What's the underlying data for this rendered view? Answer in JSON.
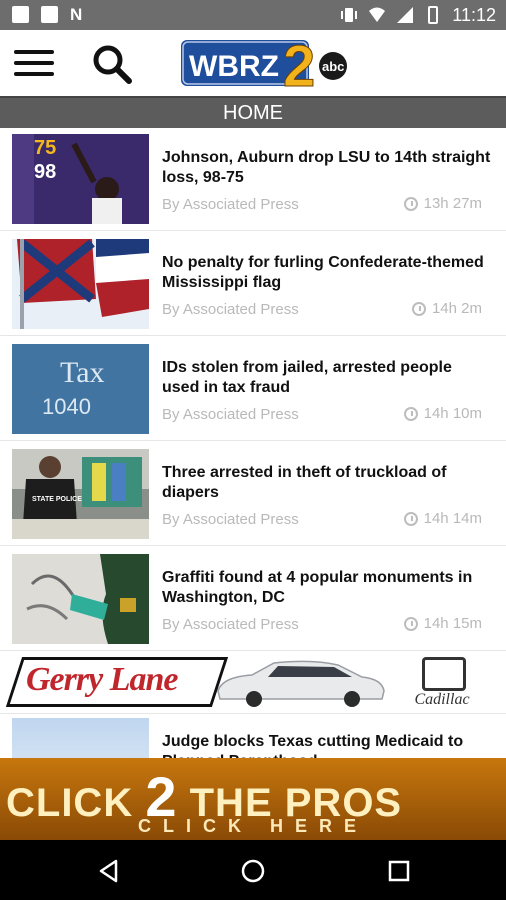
{
  "status_bar": {
    "time": "11:12",
    "left_icons": [
      "notification-icon",
      "mail-icon",
      "news-icon"
    ],
    "right_icons": [
      "vibrate-icon",
      "wifi-icon",
      "signal-icon",
      "battery-icon"
    ]
  },
  "header": {
    "logo_text": "WBRZ",
    "logo_number": "2",
    "logo_badge": "abc",
    "section_title": "HOME"
  },
  "articles": [
    {
      "title": "Johnson, Auburn drop LSU to 14th straight loss, 98-75",
      "byline": "By Associated Press",
      "ago": "13h 27m",
      "score_top": "75",
      "score_bottom": "98"
    },
    {
      "title": "No penalty for furling Confederate-themed Mississippi flag",
      "byline": "By Associated Press",
      "ago": "14h 2m"
    },
    {
      "title": "IDs stolen from jailed, arrested people used in tax fraud",
      "byline": "By Associated Press",
      "ago": "14h 10m",
      "thumb_text_1": "Tax",
      "thumb_text_2": "1040"
    },
    {
      "title": "Three arrested in theft of truckload of diapers",
      "byline": "By Associated Press",
      "ago": "14h 14m",
      "thumb_text": "STATE POLICE"
    },
    {
      "title": "Graffiti found at 4 popular monuments in Washington, DC",
      "byline": "By Associated Press",
      "ago": "14h 15m"
    }
  ],
  "ad_dealer": {
    "brand": "Gerry Lane",
    "make": "Cadillac"
  },
  "partial_article": {
    "title": "Judge blocks Texas cutting Medicaid to Planned Parenthood"
  },
  "ad_banner": {
    "line1_a": "CLICK",
    "line1_b": "2",
    "line1_c": "THE",
    "line1_d": "PROS",
    "line2": "CLICK HERE"
  },
  "colors": {
    "status_bar": "#6d6d6d",
    "section_bar": "#5c5c5c",
    "meta_text": "#b9b9b9",
    "banner_orange": "#c7770d"
  }
}
